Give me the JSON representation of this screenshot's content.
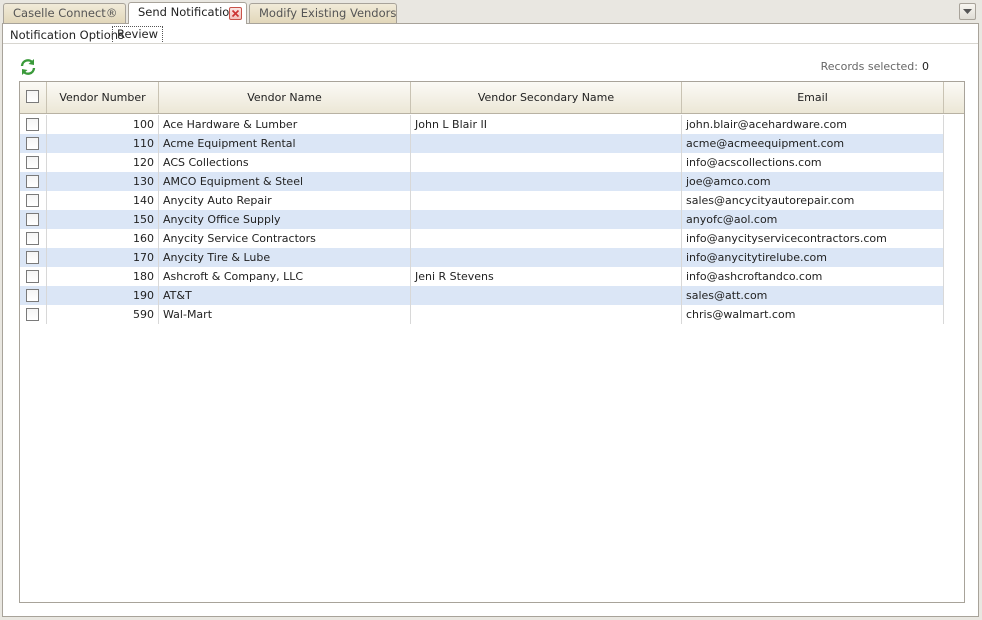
{
  "tabs": [
    {
      "label": "Caselle Connect®"
    },
    {
      "label": "Send Notifications"
    },
    {
      "label": "Modify Existing Vendors"
    }
  ],
  "subtabs": [
    {
      "label": "Notification Options"
    },
    {
      "label": "Review"
    }
  ],
  "records": {
    "label": "Records selected:",
    "count": "0"
  },
  "grid": {
    "columns": [
      "Vendor Number",
      "Vendor Name",
      "Vendor Secondary Name",
      "Email"
    ],
    "rows": [
      {
        "number": "100",
        "name": "Ace Hardware & Lumber",
        "secondary": "John L Blair II",
        "email": "john.blair@acehardware.com"
      },
      {
        "number": "110",
        "name": "Acme Equipment Rental",
        "secondary": "",
        "email": "acme@acmeequipment.com"
      },
      {
        "number": "120",
        "name": "ACS Collections",
        "secondary": "",
        "email": "info@acscollections.com"
      },
      {
        "number": "130",
        "name": "AMCO Equipment & Steel",
        "secondary": "",
        "email": "joe@amco.com"
      },
      {
        "number": "140",
        "name": "Anycity Auto Repair",
        "secondary": "",
        "email": "sales@ancycityautorepair.com"
      },
      {
        "number": "150",
        "name": "Anycity Office Supply",
        "secondary": "",
        "email": "anyofc@aol.com"
      },
      {
        "number": "160",
        "name": "Anycity Service Contractors",
        "secondary": "",
        "email": "info@anycityservicecontractors.com"
      },
      {
        "number": "170",
        "name": "Anycity Tire & Lube",
        "secondary": "",
        "email": "info@anycitytirelube.com"
      },
      {
        "number": "180",
        "name": "Ashcroft & Company, LLC",
        "secondary": "Jeni R Stevens",
        "email": "info@ashcroftandco.com"
      },
      {
        "number": "190",
        "name": "AT&T",
        "secondary": "",
        "email": "sales@att.com"
      },
      {
        "number": "590",
        "name": "Wal-Mart",
        "secondary": "",
        "email": "chris@walmart.com"
      }
    ]
  },
  "icons": {
    "refresh": "refresh-icon",
    "close": "close-icon",
    "menu": "chevron-down-icon"
  },
  "colors": {
    "alt_row": "#dbe6f6",
    "tab_bg": "#e2d7ba"
  }
}
